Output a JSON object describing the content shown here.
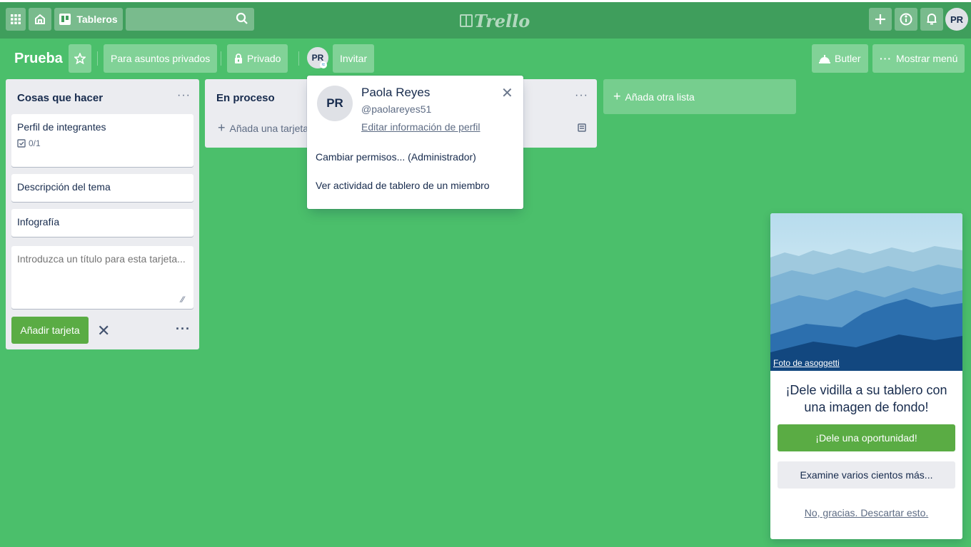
{
  "header": {
    "boards_label": "Tableros",
    "logo_text": "Trello",
    "user_initials": "PR"
  },
  "board": {
    "title": "Prueba",
    "team_label": "Para asuntos privados",
    "visibility_label": "Privado",
    "member_initials": "PR",
    "invite_label": "Invitar",
    "butler_label": "Butler",
    "menu_label": "Mostrar menú"
  },
  "lists": [
    {
      "title": "Cosas que hacer",
      "cards": [
        {
          "title": "Perfil de integrantes",
          "checklist": "0/1"
        },
        {
          "title": "Descripción del tema"
        },
        {
          "title": "Infografía"
        }
      ],
      "composer_placeholder": "Introduzca un título para esta tarjeta...",
      "add_button": "Añadir tarjeta"
    },
    {
      "title": "En proceso",
      "add_card_label": "Añada una tarjeta"
    }
  ],
  "add_list_label": "Añada otra lista",
  "member_popover": {
    "initials": "PR",
    "name": "Paola Reyes",
    "username": "@paolareyes51",
    "edit_link": "Editar información de perfil",
    "items": [
      "Cambiar permisos... (Administrador)",
      "Ver actividad de tablero de un miembro"
    ]
  },
  "background_promo": {
    "photo_credit": "Foto de asoggetti",
    "message": "¡Dele vidilla a su tablero con una imagen de fondo!",
    "primary_button": "¡Dele una oportunidad!",
    "secondary_button": "Examine varios cientos más...",
    "dismiss_link": "No, gracias. Descartar esto."
  },
  "colors": {
    "board_bg": "#4bbf6b",
    "header_bg": "#3f9e5c",
    "primary_green": "#5aac44",
    "list_bg": "#ebecf0"
  }
}
